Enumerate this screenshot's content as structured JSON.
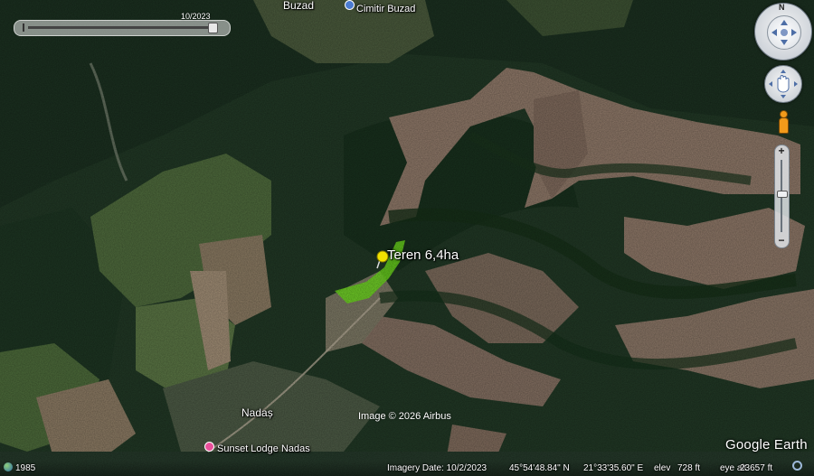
{
  "time_slider": {
    "date_label": "10/2023"
  },
  "places": {
    "buzad": "Buzad",
    "cimitir": "Cimitir Buzad",
    "nadas": "Nadaș",
    "lodge": "Sunset Lodge Nadas"
  },
  "placemark": {
    "label": "Teren 6,4ha",
    "color": "#f2e200",
    "area_color": "#6ddc1c"
  },
  "attribution": {
    "copyright": "Image © 2026 Airbus",
    "logo": "Google Earth"
  },
  "status_bar": {
    "historical_year": "1985",
    "imagery_date": "Imagery Date: 10/2/2023",
    "latitude": "45°54'48.84\" N",
    "longitude": "21°33'35.60\" E",
    "elev_label": "elev",
    "elev_value": "728 ft",
    "eye_alt_label": "eye alt",
    "eye_alt_value": "23657 ft"
  },
  "controls": {
    "compass_north": "N",
    "zoom_in": "+",
    "zoom_out": "−"
  },
  "icons": {
    "compass": "compass-icon",
    "pan": "hand-pan-icon",
    "pegman": "street-view-pegman-icon",
    "poi_cemetery": "cemetery-poi-icon",
    "poi_lodge": "lodging-poi-icon",
    "pushpin": "yellow-pushpin-icon"
  }
}
